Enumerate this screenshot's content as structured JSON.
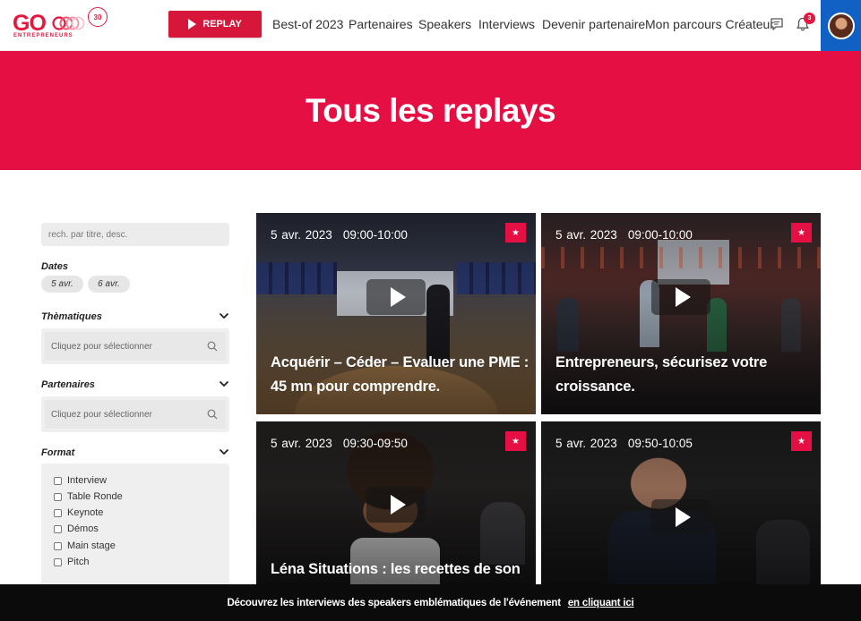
{
  "header": {
    "logo_text": "GO",
    "logo_sub": "ENTREPRENEURS",
    "logo_badge": "30",
    "replay_label": "REPLAY",
    "nav": [
      "Best-of 2023",
      "Partenaires",
      "Speakers",
      "Interviews",
      "Devenir partenaire",
      "Mon parcours Créateur"
    ],
    "notification_count": "3",
    "icons": [
      "chat-icon",
      "bell-icon",
      "avatar"
    ]
  },
  "hero": {
    "title": "Tous les replays"
  },
  "sidebar": {
    "search_placeholder": "rech. par titre, desc.",
    "dates_title": "Dates",
    "dates": [
      "5 avr.",
      "6 avr."
    ],
    "thematiques_title": "Thèmatiques",
    "thematiques_placeholder": "Cliquez pour sélectionner",
    "partenaires_title": "Partenaires",
    "partenaires_placeholder": "Cliquez pour sélectionner",
    "format_title": "Format",
    "formats": [
      "Interview",
      "Table Ronde",
      "Keynote",
      "Démos",
      "Main stage",
      "Pitch"
    ]
  },
  "cards": [
    {
      "date": "5 avr. 2023",
      "time": "09:00-10:00",
      "title_line1": "Acquérir – Céder – Evaluer une PME :",
      "title_line2": "45 mn pour comprendre."
    },
    {
      "date": "5 avr. 2023",
      "time": "09:00-10:00",
      "title_line1": "Entrepreneurs, sécurisez votre",
      "title_line2": "croissance."
    },
    {
      "date": "5 avr. 2023",
      "time": "09:30-09:50",
      "title_line1": "Léna Situations : les recettes de son",
      "title_line2": ""
    },
    {
      "date": "5 avr. 2023",
      "time": "09:50-10:05",
      "title_line1": "",
      "title_line2": ""
    }
  ],
  "banner": {
    "text": "Découvrez les interviews des speakers emblématiques de l'événement",
    "link": "en cliquant ici"
  },
  "colors": {
    "brand_red": "#e60f43",
    "button_red": "#d7163b",
    "avatar_blue": "#1160c4",
    "banner_black": "#0b0b0b"
  }
}
